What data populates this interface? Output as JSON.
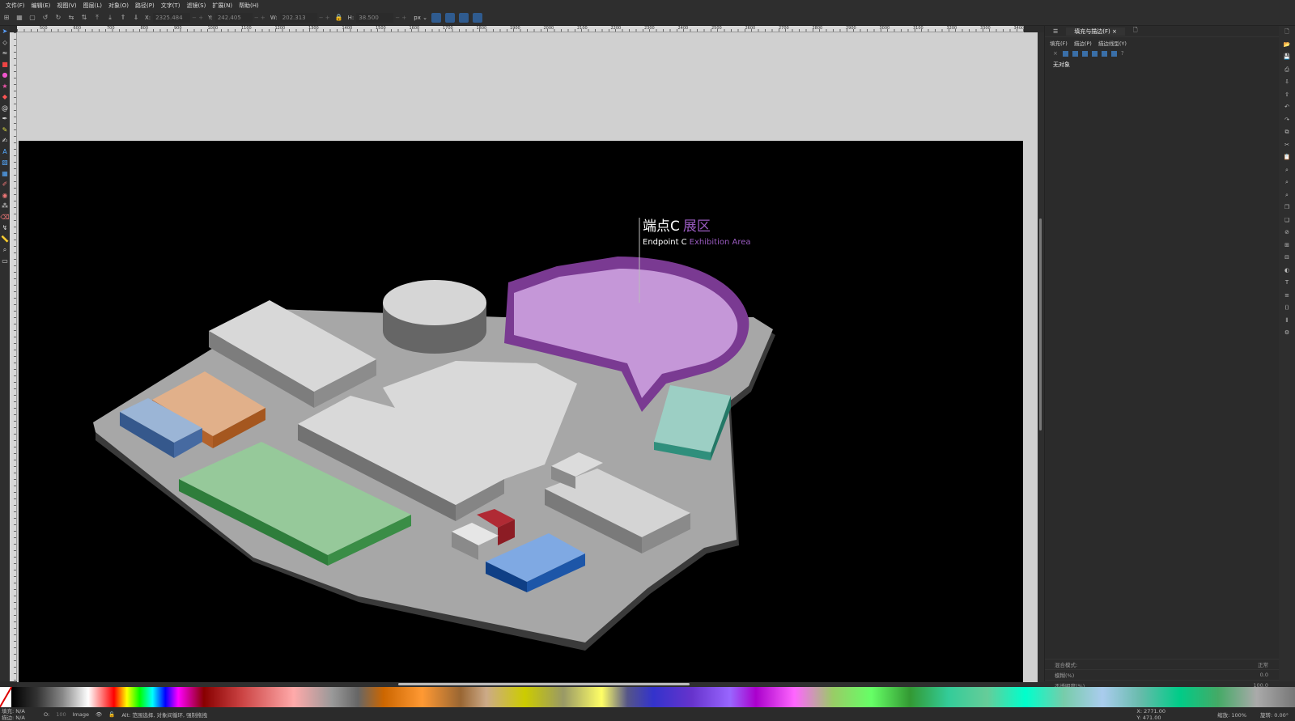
{
  "menu": [
    "文件(F)",
    "编辑(E)",
    "视图(V)",
    "图层(L)",
    "对象(O)",
    "路径(P)",
    "文字(T)",
    "滤镜(S)",
    "扩展(N)",
    "帮助(H)"
  ],
  "toolbar": {
    "x_label": "X:",
    "x_value": "2325.484",
    "y_label": "Y:",
    "y_value": "242.405",
    "w_label": "W:",
    "w_value": "202.313",
    "h_label": "H:",
    "h_value": "38.500",
    "unit": "px"
  },
  "panel": {
    "tab_fill_stroke": "填充与描边(F)",
    "sub_fill": "填充(F)",
    "sub_stroke_paint": "描边(P)",
    "sub_stroke_style": "描边线型(Y)",
    "no_object": "无对象",
    "blend_label": "混合模式:",
    "blend_value": "正常",
    "blur_label": "模糊(%)",
    "blur_value": "0.0",
    "opacity_label": "不透明度(%)",
    "opacity_value": "100.0"
  },
  "canvas": {
    "title_cn_main": "端点C",
    "title_cn_accent": "展区",
    "title_en_main": "Endpoint C",
    "title_en_accent": "Exhibition Area"
  },
  "ruler_ticks": [
    "500",
    "600",
    "700",
    "800",
    "900",
    "1000",
    "1100",
    "1200",
    "1300",
    "1400",
    "1500",
    "1600",
    "1700",
    "1800",
    "1900",
    "2000",
    "2100",
    "2200",
    "2300",
    "2400",
    "2500",
    "2600",
    "2700",
    "2800",
    "2900",
    "3000",
    "3100",
    "3200",
    "3300",
    "3400"
  ],
  "status": {
    "fill_label": "填充:",
    "fill_value": "N/A",
    "stroke_label": "描边:",
    "stroke_value": "N/A",
    "opacity_label": "O:",
    "opacity_value": "100",
    "layer": "Image",
    "hint": "Alt: 范围选择, 对象间循环, 强制拖拽",
    "x_coord": "X: 2771.00",
    "y_coord": "Y: 471.00",
    "zoom_label": "缩放:",
    "zoom_value": "100%",
    "rotate_label": "旋转:",
    "rotate_value": "0.00°"
  },
  "colors": {
    "purple_zone": "#c597d8",
    "purple_wall": "#7a3a92",
    "teal_zone": "#2f8f7c",
    "green_zone": "#3e9a4a",
    "orange_zone": "#c56d2c",
    "blue_zone": "#1d56a8",
    "red_block": "#b02a34",
    "floor": "#a5a5a5"
  }
}
